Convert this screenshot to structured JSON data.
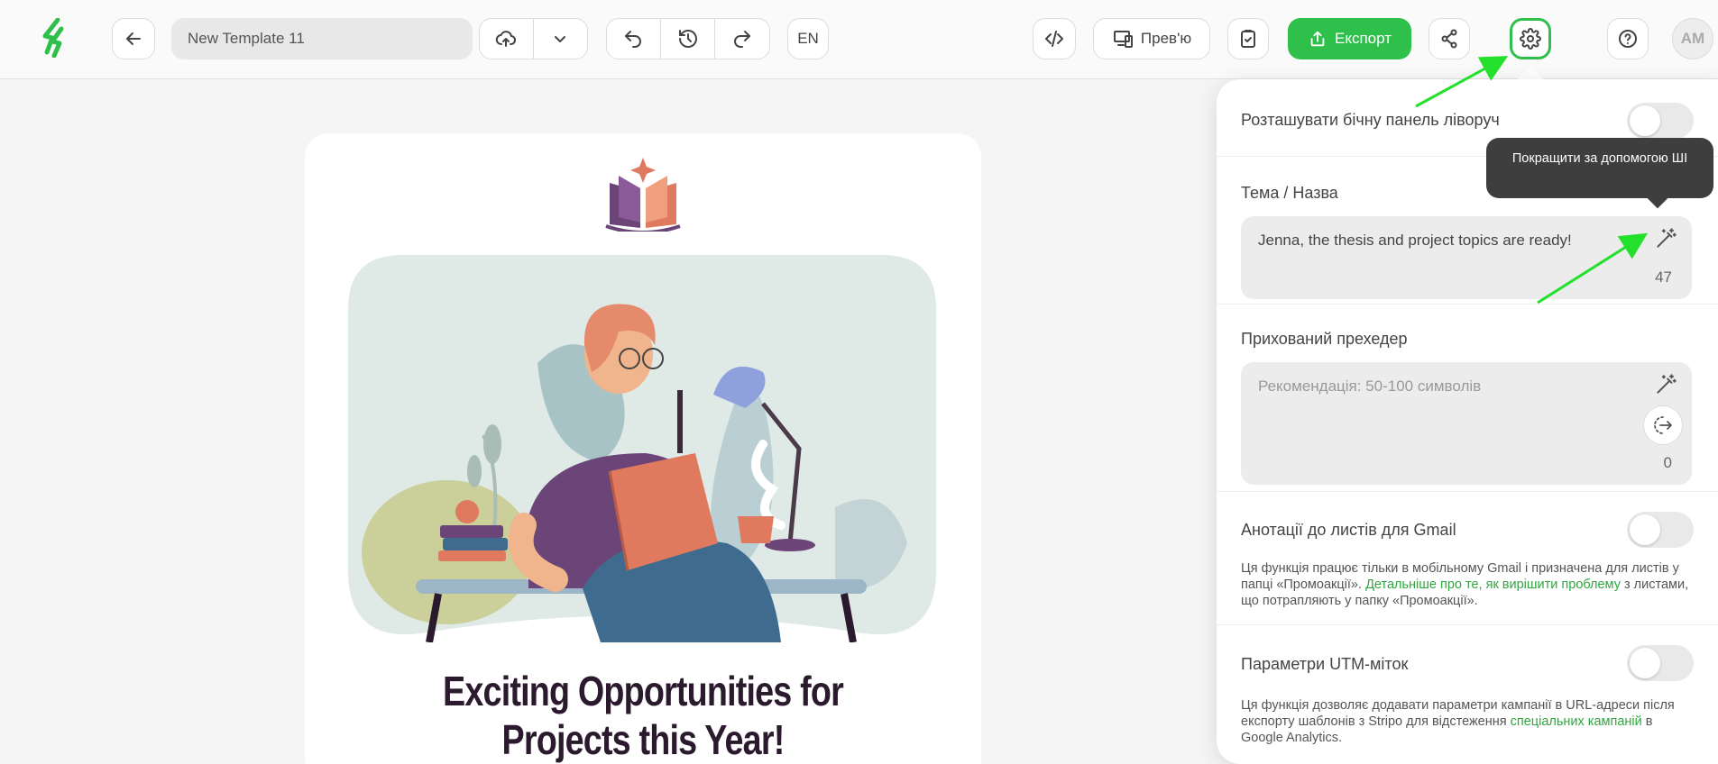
{
  "toolbar": {
    "template_name": "New Template 11",
    "language": "EN",
    "preview_label": "Прев'ю",
    "export_label": "Експорт",
    "avatar_initials": "AM"
  },
  "email": {
    "title_line1": "Exciting Opportunities for",
    "title_line2": "Projects this Year!"
  },
  "settings": {
    "sidebar_left_label": "Розташувати бічну панель ліворуч",
    "subject_label": "Тема / Назва",
    "subject_value": "Jenna, the thesis and project topics are ready!",
    "subject_count": "47",
    "preheader_label": "Прихований прехедер",
    "preheader_placeholder": "Рекомендація: 50-100 символів",
    "preheader_count": "0",
    "gmail_label": "Анотації до листів для Gmail",
    "gmail_desc_1": "Ця функція працює тільки в мобільному Gmail і призначена для листів у папці «Промоакції». ",
    "gmail_desc_link": "Детальніше про те, як вирішити проблему",
    "gmail_desc_2": " з листами, що потрапляють у папку «Промоакції».",
    "utm_label": "Параметри UTM-міток",
    "utm_desc_1": "Ця функція дозволяє додавати параметри кампанії в URL-адреси після експорту шаблонів з Stripo для відстеження ",
    "utm_desc_link": "спеціальних кампаній",
    "utm_desc_2": " в Google Analytics."
  },
  "tooltip": {
    "text": "Покращити за допомогою ШІ"
  },
  "colors": {
    "accent": "#2ec04b",
    "link": "#2ea83f",
    "tooltip_bg": "#3e3e3e"
  },
  "icons": [
    "stripo-logo-icon",
    "back-arrow-icon",
    "cloud-upload-icon",
    "chevron-down-icon",
    "undo-icon",
    "history-icon",
    "redo-icon",
    "code-icon",
    "devices-icon",
    "clipboard-check-icon",
    "export-icon",
    "share-icon",
    "gear-icon",
    "help-icon",
    "magic-wand-icon",
    "insert-text-icon"
  ]
}
